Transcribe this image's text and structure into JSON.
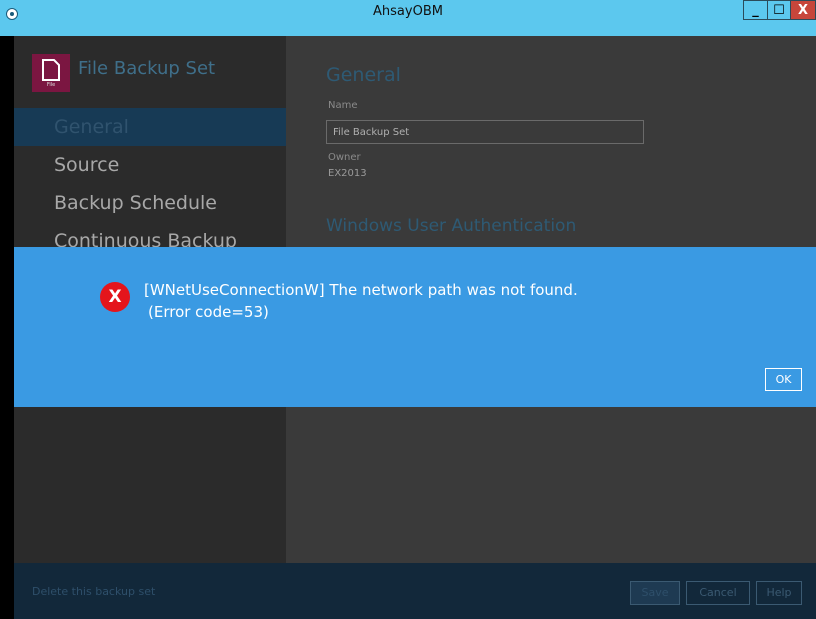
{
  "window": {
    "title": "AhsayOBM",
    "minimize": "_",
    "maximize": "☐",
    "close": "X"
  },
  "sidebar": {
    "logo_label": "File",
    "set_title": "File Backup Set",
    "items": [
      {
        "label": "General"
      },
      {
        "label": "Source"
      },
      {
        "label": "Backup Schedule"
      },
      {
        "label": "Continuous Backup"
      }
    ]
  },
  "main": {
    "heading": "General",
    "name_label": "Name",
    "name_value": "File Backup Set",
    "owner_label": "Owner",
    "owner_value": "EX2013",
    "auth_heading": "Windows User Authentication"
  },
  "footer": {
    "delete_label": "Delete this backup set",
    "save": "Save",
    "cancel": "Cancel",
    "help": "Help"
  },
  "dialog": {
    "icon": "error-x-icon",
    "message_line1": "[WNetUseConnectionW] The network path was not found.",
    "message_line2": "(Error code=53)",
    "ok": "OK"
  },
  "colors": {
    "titlebar": "#5cc8ee",
    "dialog": "#3a9ae3",
    "error": "#e4151c",
    "brand": "#7b1641"
  }
}
